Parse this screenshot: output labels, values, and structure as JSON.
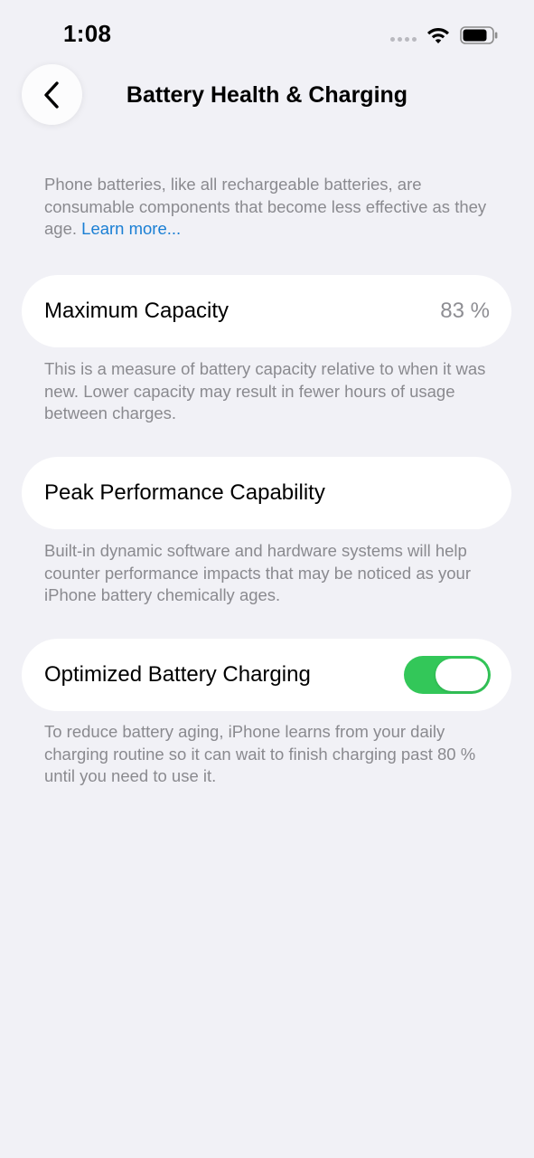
{
  "status_bar": {
    "time": "1:08"
  },
  "nav": {
    "title": "Battery Health & Charging"
  },
  "intro": {
    "text": "Phone batteries, like all rechargeable batteries, are consumable components that become less effective as they age.",
    "link_label": "Learn more..."
  },
  "maximum_capacity": {
    "label": "Maximum Capacity",
    "value": "83 %",
    "footnote": "This is a measure of battery capacity relative to when it was new. Lower capacity may result in fewer hours of usage between charges."
  },
  "peak_performance": {
    "label": "Peak Performance Capability",
    "footnote": "Built-in dynamic software and hardware systems will help counter performance impacts that may be noticed as your iPhone battery chemically ages."
  },
  "optimized_charging": {
    "label": "Optimized Battery Charging",
    "enabled": true,
    "footnote": "To reduce battery aging, iPhone learns from your daily charging routine so it can wait to finish charging past 80 % until you need to use it."
  },
  "colors": {
    "background": "#f1f1f6",
    "card": "#ffffff",
    "secondary_text": "#8a8a8f",
    "link": "#1a7fd4",
    "toggle_on": "#33c759"
  },
  "icons": [
    "signal-icon",
    "wifi-icon",
    "battery-icon",
    "chevron-left-icon"
  ]
}
